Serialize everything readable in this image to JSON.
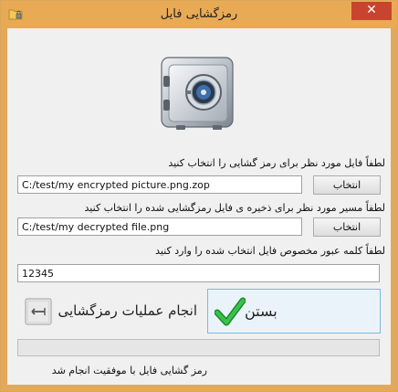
{
  "window": {
    "title": "رمزگشایی فایل",
    "close_glyph": "✕"
  },
  "source": {
    "label": "لطفاً فایل مورد نظر برای رمز گشایی را انتخاب کنید",
    "value": "C:/test/my encrypted picture.png.zop",
    "browse_label": "انتخاب"
  },
  "destination": {
    "label": "لطفاً مسیر مورد نظر برای ذخیره ی فایل رمزگشایی شده را انتخاب کنید",
    "value": "C:/test/my decrypted file.png",
    "browse_label": "انتخاب"
  },
  "password": {
    "label": "لطفاً کلمه عبور مخصوص فایل انتخاب شده را وارد کنید",
    "value": "12345"
  },
  "actions": {
    "decrypt_label": "انجام عملیات رمزگشایی",
    "close_label": "بستن"
  },
  "progress": {
    "value": 0
  },
  "status": {
    "text": "رمز گشایی فایل با موفقیت انجام شد"
  },
  "icons": {
    "app": "folder-lock-icon",
    "safe": "safe-icon",
    "decrypt": "key-icon",
    "close": "checkmark-icon"
  },
  "colors": {
    "titlebar": "#e9aa55",
    "close_button": "#c9442f",
    "check_green": "#21a336",
    "progress_fill": "#06b025"
  }
}
